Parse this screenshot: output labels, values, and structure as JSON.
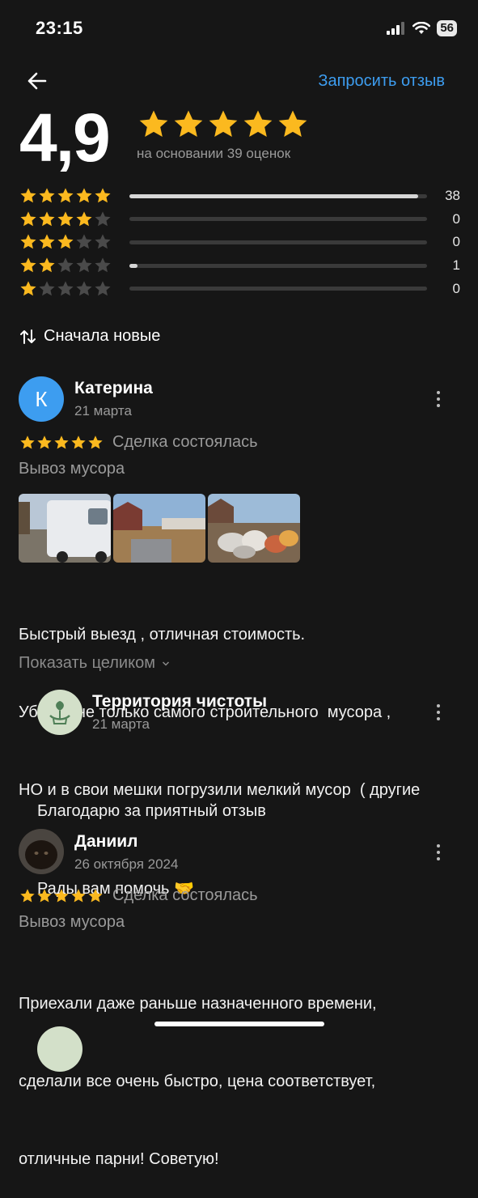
{
  "status_bar": {
    "time": "23:15",
    "battery": "56"
  },
  "header": {
    "request_review": "Запросить отзыв"
  },
  "summary": {
    "rating": "4,9",
    "stars": 5,
    "based_on": "на основании 39 оценок"
  },
  "distribution": [
    {
      "stars": 5,
      "count": "38",
      "fraction": 0.97
    },
    {
      "stars": 4,
      "count": "0",
      "fraction": 0
    },
    {
      "stars": 3,
      "count": "0",
      "fraction": 0
    },
    {
      "stars": 2,
      "count": "1",
      "fraction": 0.026
    },
    {
      "stars": 1,
      "count": "0",
      "fraction": 0
    }
  ],
  "sort": {
    "label": "Сначала новые"
  },
  "reviews": [
    {
      "avatar_letter": "К",
      "author": "Катерина",
      "date": "21 марта",
      "stars": 5,
      "deal_status": "Сделка состоялась",
      "category": "Вывоз мусора",
      "text_lines": [
        "Быстрый выезд , отличная стоимость.",
        "Уборка не только самого строительного  мусора ,",
        "НО и в свои мешки погрузили мелкий мусор  ( другие"
      ],
      "show_more": "Показать целиком",
      "reply": {
        "author": "Территория чистоты",
        "date": "21 марта",
        "text_lines": [
          "Благодарю за приятный отзыв",
          "Рады вам помочь 🤝"
        ]
      }
    },
    {
      "author": "Даниил",
      "date": "26 октября 2024",
      "stars": 5,
      "deal_status": "Сделка состоялась",
      "category": "Вывоз мусора",
      "text_lines": [
        "Приехали даже раньше назначенного времени,",
        "сделали все очень быстро, цена соответствует,",
        "отличные парни! Советую!"
      ]
    }
  ],
  "colors": {
    "accent": "#3d9df0",
    "star": "#fbb91f",
    "star_empty": "#4a4a4a",
    "avatar": "#3d9df0"
  }
}
